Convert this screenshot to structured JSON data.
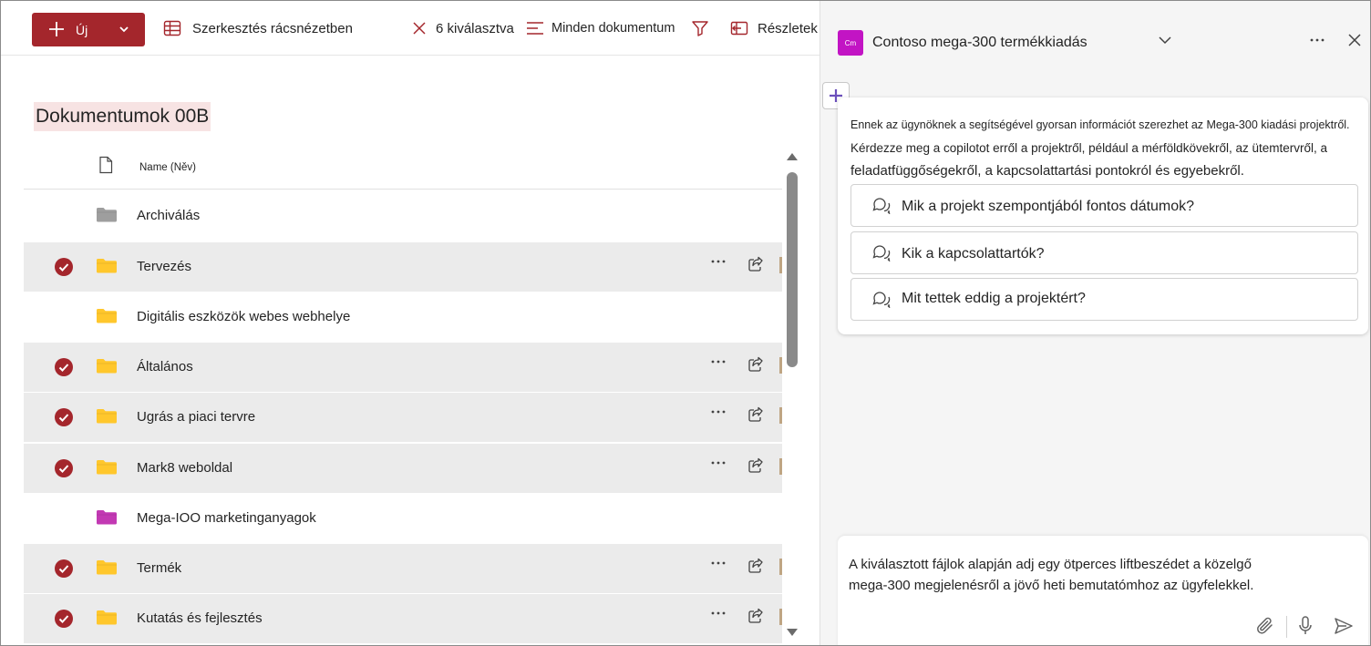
{
  "toolbar": {
    "new_label": "Új",
    "grid_edit_label": "Szerkesztés rácsnézetben",
    "selected_label": "6 kiválasztva",
    "view_label": "Minden dokumentum",
    "details_label": "Részletek"
  },
  "library": {
    "title": "Dokumentumok 00B",
    "name_column": "Name (Něv)",
    "items": [
      {
        "name": "Archiválás",
        "selected": false,
        "folder_color": "#9e9e9e"
      },
      {
        "name": "Tervezés",
        "selected": true,
        "folder_color": "#ffc72c"
      },
      {
        "name": "Digitális eszközök webes webhelye",
        "selected": false,
        "folder_color": "#ffc72c"
      },
      {
        "name": "Általános",
        "selected": true,
        "folder_color": "#ffc72c"
      },
      {
        "name": "Ugrás a piaci tervre",
        "selected": true,
        "folder_color": "#ffc72c"
      },
      {
        "name": "Mark8 weboldal",
        "selected": true,
        "folder_color": "#ffc72c"
      },
      {
        "name": "Mega-IOO marketinganyagok",
        "selected": false,
        "folder_color": "#c239b3"
      },
      {
        "name": "Termék",
        "selected": true,
        "folder_color": "#ffc72c"
      },
      {
        "name": "Kutatás és fejlesztés",
        "selected": true,
        "folder_color": "#ffc72c"
      }
    ]
  },
  "agent": {
    "badge": "Cm",
    "name": "Contoso mega-300 termékkiadás",
    "intro_line1": "Ennek az ügynöknek a segítségével gyorsan információt szerezhet az Mega-300 kiadási projektről.",
    "intro_line2": "Kérdezze meg a copilotot erről a projektről, például a mérföldkövekről, az ütemtervről, a",
    "intro_line3": "feladatfüggőségekről, a kapcsolattartási pontokról és egyebekről.",
    "suggestions": [
      "Mik a projekt szempontjából fontos dátumok?",
      "Kik a kapcsolattartók?",
      "Mit tettek eddig a projektért?"
    ],
    "prompt_line1": "A kiválasztott fájlok alapján adj egy ötperces liftbeszédet a közelgő",
    "prompt_line2": "mega-300 megjelenésről a jövő heti bemutatómhoz az ügyfelekkel."
  },
  "colors": {
    "accent": "#a4262c",
    "agent_badge": "#c214c4",
    "selected_row": "#ebebeb"
  }
}
